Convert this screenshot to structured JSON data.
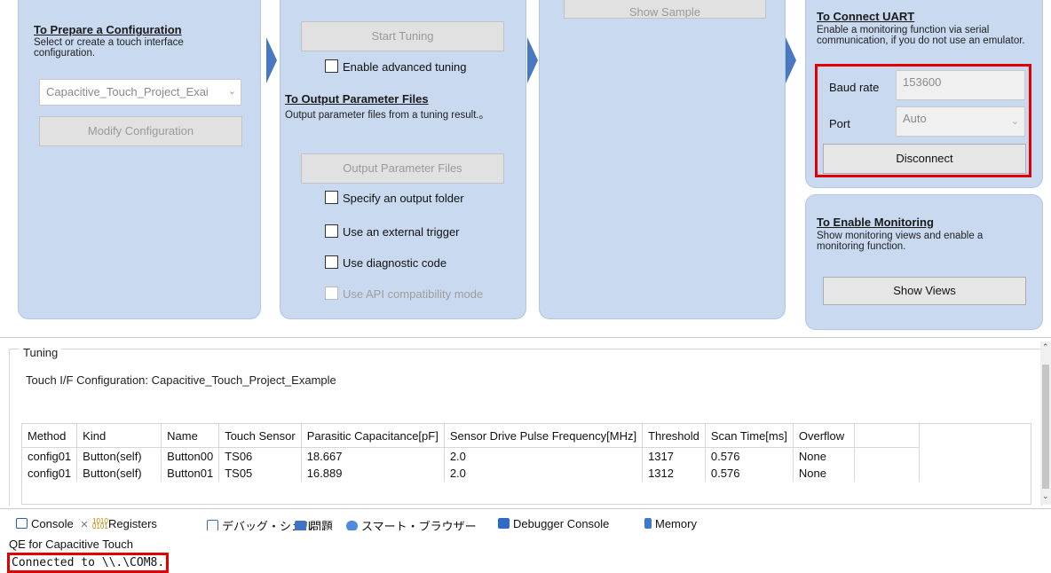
{
  "prepare": {
    "title": "To Prepare a Configuration",
    "desc": "Select or create a touch interface configuration.",
    "config_value": "Capacitive_Touch_Project_Exai",
    "modify_button": "Modify Configuration"
  },
  "tuning_panel": {
    "start_button": "Start Tuning",
    "advanced_label": "Enable advanced tuning",
    "output_title": "To Output Parameter Files",
    "output_desc": "Output parameter files from a tuning result.。",
    "output_button": "Output Parameter Files",
    "specify_folder": "Specify an output folder",
    "external_trigger": "Use an external trigger",
    "diagnostic": "Use diagnostic code",
    "api_compat": "Use API compatibility mode"
  },
  "sample": {
    "show_sample": "Show Sample"
  },
  "uart": {
    "title": "To Connect UART",
    "desc": "Enable a monitoring function via serial communication, if you do not use an emulator.",
    "baud_label": "Baud rate",
    "baud_value": "153600",
    "port_label": "Port",
    "port_value": "Auto",
    "disconnect_button": "Disconnect"
  },
  "monitor": {
    "title": "To Enable Monitoring",
    "desc": "Show monitoring views and enable a monitoring function.",
    "show_views_button": "Show Views"
  },
  "tuning": {
    "group_label": "Tuning",
    "config_line": "Touch I/F Configuration: Capacitive_Touch_Project_Example",
    "columns": [
      "Method",
      "Kind",
      "Name",
      "Touch Sensor",
      "Parasitic Capacitance[pF]",
      "Sensor Drive Pulse Frequency[MHz]",
      "Threshold",
      "Scan Time[ms]",
      "Overflow"
    ],
    "rows": [
      [
        "config01",
        "Button(self)",
        "Button00",
        "TS06",
        "18.667",
        "2.0",
        "1317",
        "0.576",
        "None"
      ],
      [
        "config01",
        "Button(self)",
        "Button01",
        "TS05",
        "16.889",
        "2.0",
        "1312",
        "0.576",
        "None"
      ]
    ]
  },
  "tabs": {
    "console": "Console",
    "console_close": "✕",
    "registers": "Registers",
    "debug_shell": "デバッグ・シェル",
    "problems": "問題",
    "smart_browser": "スマート・ブラウザー",
    "debugger_console": "Debugger Console",
    "memory": "Memory"
  },
  "console": {
    "title": "QE for Capacitive Touch",
    "line": "Connected to \\\\.\\COM8."
  },
  "colors": {
    "panel": "#c9d9ef",
    "arrow": "#4a78c0",
    "highlight": "#e00000"
  }
}
